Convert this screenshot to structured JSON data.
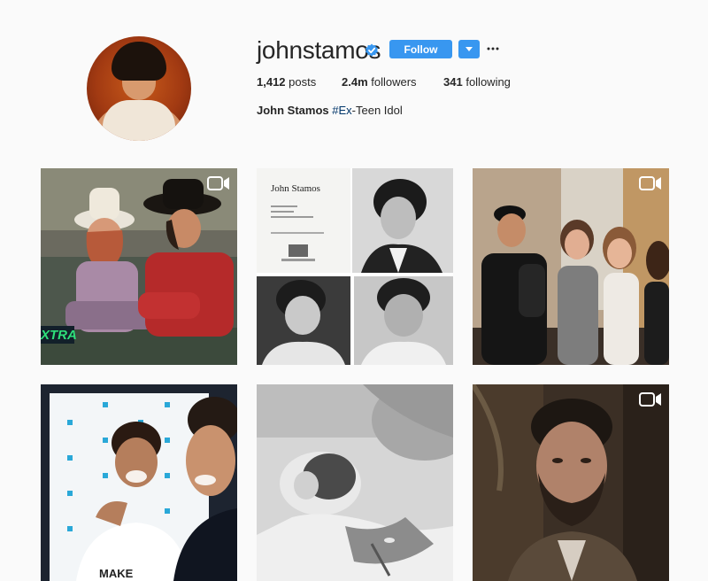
{
  "profile": {
    "username": "johnstamos",
    "follow_label": "Follow",
    "stats": {
      "posts_count": "1,412",
      "posts_label": "posts",
      "followers_count": "2.4m",
      "followers_label": "followers",
      "following_count": "341",
      "following_label": "following"
    },
    "bio": {
      "name": "John Stamos",
      "hashtag": "#Ex",
      "suffix": "-Teen Idol"
    }
  },
  "posts": [
    {
      "kind": "video",
      "overlay_text": "XTRA"
    },
    {
      "kind": "photo",
      "overlay_text": "John Stamos"
    },
    {
      "kind": "video",
      "overlay_text": ""
    },
    {
      "kind": "photo",
      "overlay_text": "MAKE"
    },
    {
      "kind": "photo",
      "overlay_text": ""
    },
    {
      "kind": "video",
      "overlay_text": ""
    }
  ],
  "colors": {
    "accent": "#3897f0",
    "verified": "#3897f0",
    "hashtag": "#003569",
    "background": "#fafafa"
  },
  "icons": [
    "verified-badge-icon",
    "chevron-down-icon",
    "more-options-icon",
    "video-camera-icon"
  ]
}
